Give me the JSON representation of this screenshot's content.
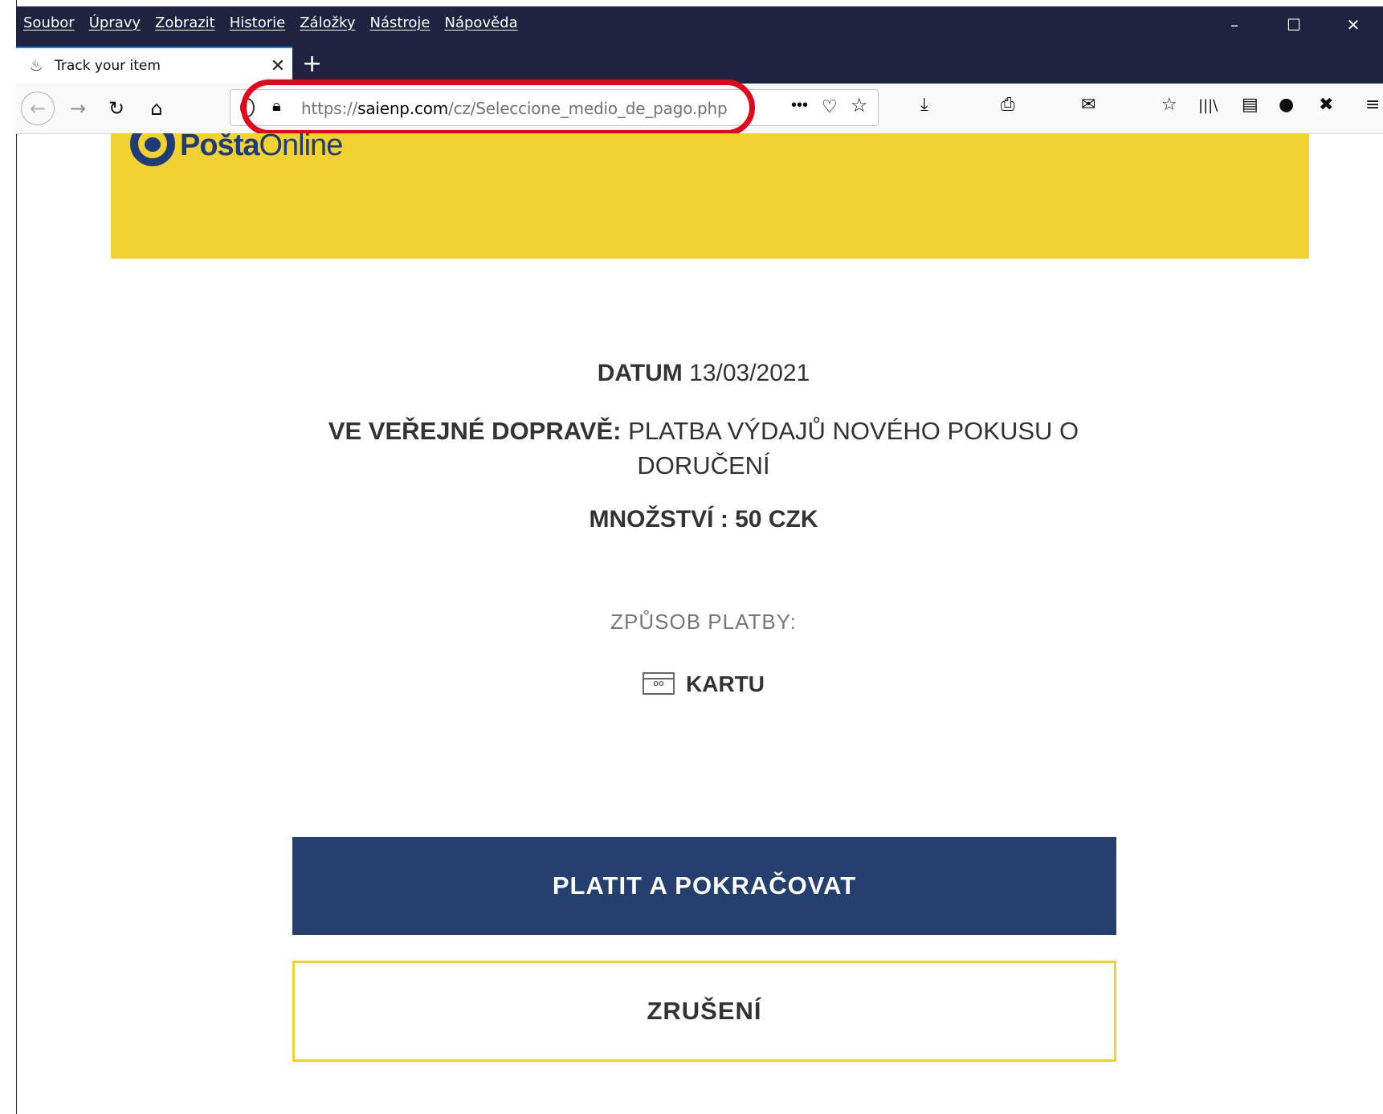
{
  "menu": [
    "Soubor",
    "Úpravy",
    "Zobrazit",
    "Historie",
    "Záložky",
    "Nástroje",
    "Nápověda"
  ],
  "window_controls": {
    "minimize": "–",
    "maximize": "☐",
    "close": "✕"
  },
  "tab": {
    "title": "Track your item",
    "close": "✕"
  },
  "new_tab": "+",
  "toolbar": {
    "back": "←",
    "forward": "→",
    "reload": "↻",
    "home": "⌂"
  },
  "urlbar": {
    "scheme": "https://",
    "host": "saienp.com",
    "path": "/cz/Seleccione_medio_de_pago.php",
    "more": "•••",
    "pocket": "♡",
    "star": "☆"
  },
  "toolbar_icons": {
    "download": "⤓",
    "print": "⎙",
    "mail": "✉",
    "bookmarks": "☆",
    "library": "|||\\",
    "sidebar": "▤",
    "account": "●",
    "extension": "✖",
    "menu": "≡"
  },
  "page": {
    "logo_bold": "Pošta",
    "logo_light": "Online",
    "date_label": "DATUM",
    "date_value": "13/03/2021",
    "transport_label": "VE VEŘEJNÉ DOPRAVĚ:",
    "transport_value": "PLATBA VÝDAJŮ NOVÉHO POKUSU O DORUČENÍ",
    "amount": "MNOŽSTVÍ : 50 CZK",
    "method_label": "ZPŮSOB PLATBY:",
    "card_icon": "oo",
    "card_label": "KARTU",
    "pay_button": "PLATIT A POKRAČOVAT",
    "cancel_button": "ZRUŠENÍ"
  },
  "colors": {
    "chrome": "#1f2340",
    "banner": "#f2d231",
    "brand_blue": "#253f6e",
    "highlight": "#e3051b"
  }
}
